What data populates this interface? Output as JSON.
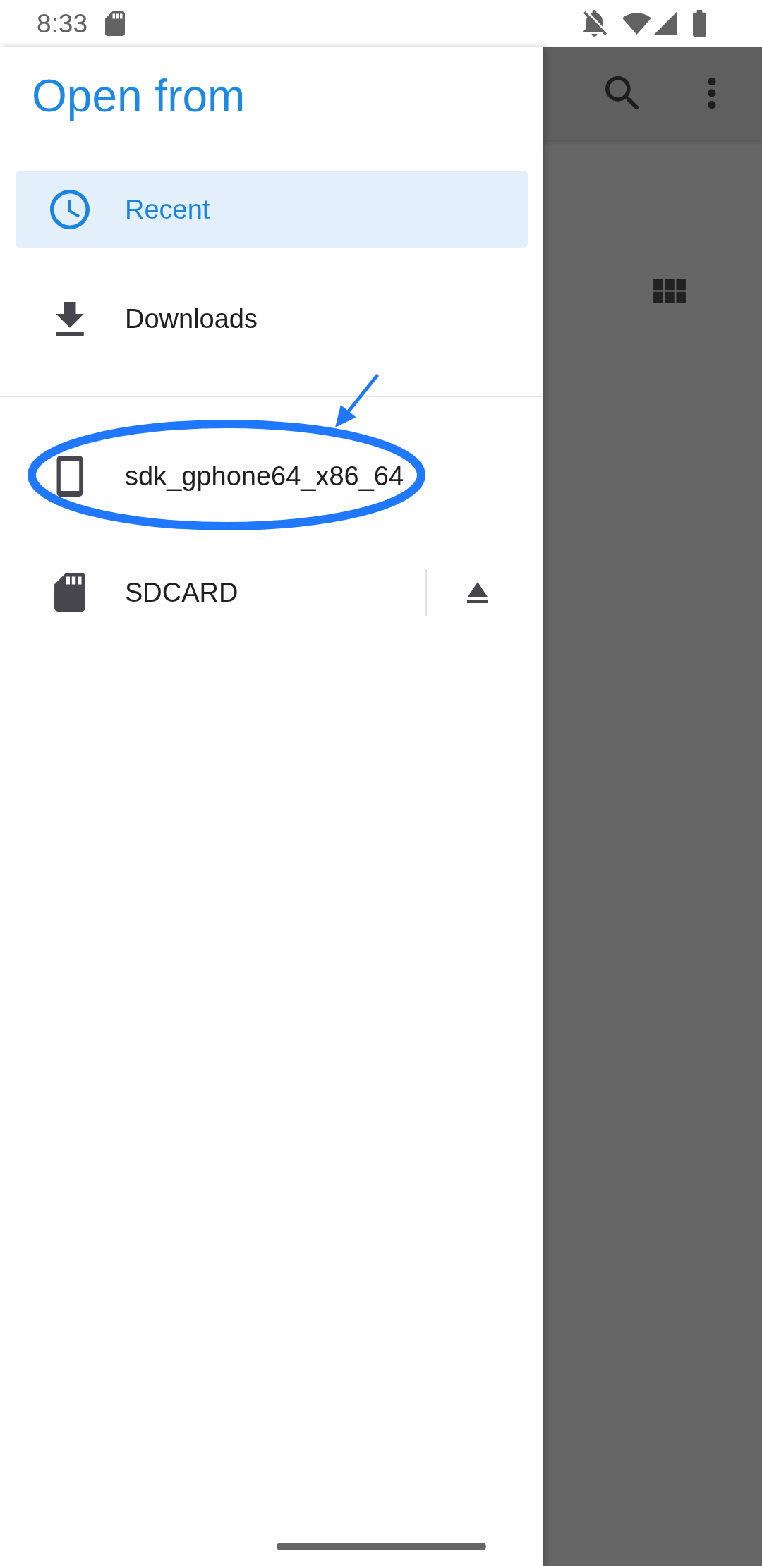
{
  "status_bar": {
    "time": "8:33"
  },
  "drawer": {
    "title": "Open from",
    "sections": [
      {
        "items": [
          {
            "kind": "recent",
            "label": "Recent",
            "selected": true,
            "highlighted": false,
            "eject": false
          },
          {
            "kind": "downloads",
            "label": "Downloads",
            "selected": false,
            "highlighted": false,
            "eject": false
          }
        ]
      },
      {
        "items": [
          {
            "kind": "device",
            "label": "sdk_gphone64_x86_64",
            "selected": false,
            "highlighted": true,
            "eject": false
          },
          {
            "kind": "storage",
            "label": "SDCARD",
            "selected": false,
            "highlighted": false,
            "eject": true
          }
        ]
      }
    ]
  }
}
